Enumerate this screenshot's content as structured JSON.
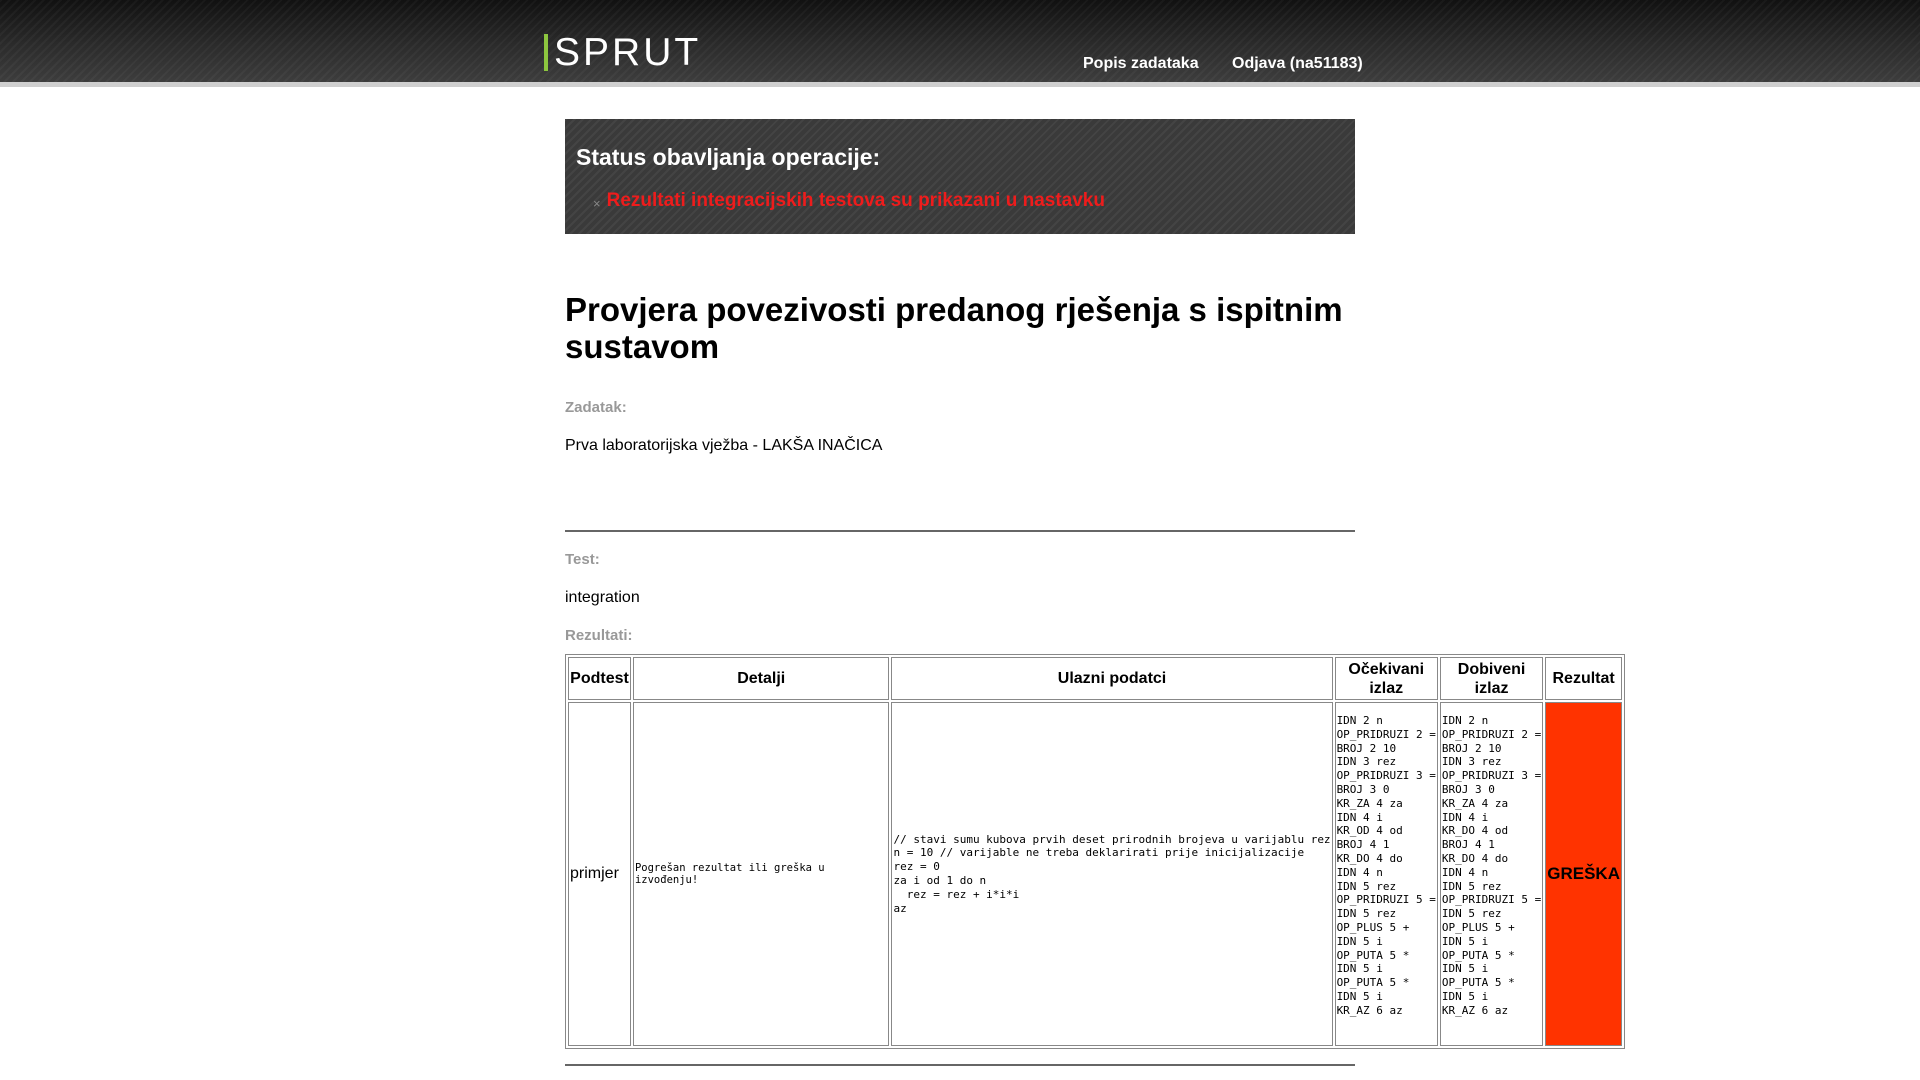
{
  "header": {
    "logo": "SPRUT",
    "nav": {
      "tasks": "Popis zadataka",
      "logout": "Odjava (na51183)"
    }
  },
  "status": {
    "title": "Status obavljanja operacije:",
    "message": "Rezultati integracijskih testova su prikazani u nastavku",
    "colors": {
      "message": "#ee1c1c"
    }
  },
  "main": {
    "title": "Provjera povezivosti predanog rješenja s ispitnim sustavom",
    "task_label": "Zadatak:",
    "task_value": "Prva laboratorijska vježba - LAKŠA INAČICA",
    "test_label": "Test:",
    "test_value": "integration",
    "results_label": "Rezultati:"
  },
  "table": {
    "headers": {
      "subtest": "Podtest",
      "details": "Detalji",
      "input": "Ulazni podatci",
      "expected": "Očekivani izlaz",
      "actual": "Dobiveni izlaz",
      "result": "Rezultat"
    },
    "rows": [
      {
        "subtest": "primjer",
        "details": "Pogrešan rezultat ili greška u izvođenju!",
        "input": "// stavi sumu kubova prvih deset prirodnih brojeva u varijablu rez\nn = 10 // varijable ne treba deklarirati prije inicijalizacije\nrez = 0\nza i od 1 do n\n  rez = rez + i*i*i\naz",
        "expected": [
          "IDN 2 n",
          "OP_PRIDRUZI 2 =",
          "BROJ 2 10",
          "IDN 3 rez",
          "OP_PRIDRUZI 3 =",
          "BROJ 3 0",
          "KR_ZA 4 za",
          "IDN 4 i",
          "KR_OD 4 od",
          "BROJ 4 1",
          "KR_DO 4 do",
          "IDN 4 n",
          "IDN 5 rez",
          "OP_PRIDRUZI 5 =",
          "IDN 5 rez",
          "OP_PLUS 5 +",
          "IDN 5 i",
          "OP_PUTA 5 *",
          "IDN 5 i",
          "OP_PUTA 5 *",
          "IDN 5 i",
          "KR_AZ 6 az"
        ],
        "actual": [
          "IDN 2 n",
          "OP_PRIDRUZI 2 =",
          "BROJ 2 10",
          "IDN 3 rez",
          "OP_PRIDRUZI 3 =",
          "BROJ 3 0",
          "KR_ZA 4 za",
          "IDN 4 i",
          "KR_DO 4 od",
          "BROJ 4 1",
          "KR_DO 4 do",
          "IDN 4 n",
          "IDN 5 rez",
          "OP_PRIDRUZI 5 =",
          "IDN 5 rez",
          "OP_PLUS 5 +",
          "IDN 5 i",
          "OP_PUTA 5 *",
          "IDN 5 i",
          "OP_PUTA 5 *",
          "IDN 5 i",
          "KR_AZ 6 az"
        ],
        "result": "GREŠKA",
        "result_color": "#ff3300"
      }
    ]
  }
}
